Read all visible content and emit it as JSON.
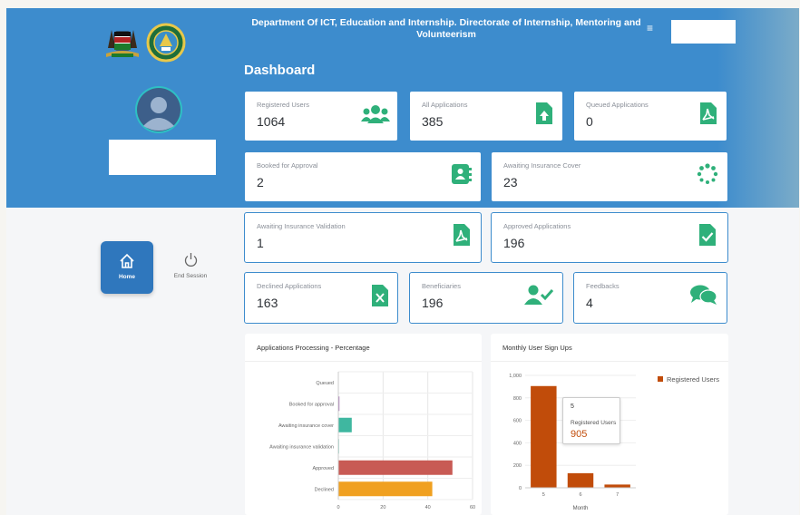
{
  "header": {
    "title": "Department Of ICT, Education and Internship. Directorate of Internship, Mentoring and Volunteerism",
    "menu_icon": "hamburger-icon"
  },
  "dashboard": {
    "title": "Dashboard"
  },
  "stats": [
    {
      "label": "Registered Users",
      "value": "1064",
      "icon": "users-icon",
      "color": "#2fb07a"
    },
    {
      "label": "All Applications",
      "value": "385",
      "icon": "file-upload-icon",
      "color": "#2fb07a"
    },
    {
      "label": "Queued Applications",
      "value": "0",
      "icon": "file-pdf-icon",
      "color": "#2fb07a"
    },
    {
      "label": "Booked for Approval",
      "value": "2",
      "icon": "address-book-icon",
      "color": "#2fb07a"
    },
    {
      "label": "Awaiting Insurance Cover",
      "value": "23",
      "icon": "spinner-icon",
      "color": "#2fb07a"
    },
    {
      "label": "Awaiting Insurance Validation",
      "value": "1",
      "icon": "file-pdf-icon",
      "color": "#2fb07a"
    },
    {
      "label": "Approved Applications",
      "value": "196",
      "icon": "file-check-icon",
      "color": "#2fb07a"
    },
    {
      "label": "Declined Applications",
      "value": "163",
      "icon": "file-excel-icon",
      "color": "#2fb07a"
    },
    {
      "label": "Beneficiaries",
      "value": "196",
      "icon": "user-check-icon",
      "color": "#2fb07a"
    },
    {
      "label": "Feedbacks",
      "value": "4",
      "icon": "comments-icon",
      "color": "#2fb07a"
    }
  ],
  "sidebar": {
    "home_label": "Home",
    "end_label": "End Session"
  },
  "chart_data": [
    {
      "type": "bar",
      "orientation": "horizontal",
      "title": "Applications Processing - Percentage",
      "categories": [
        "Queued",
        "Booked for approval",
        "Awaiting insurance cover",
        "Awaiting insurance validation",
        "Approved",
        "Declined"
      ],
      "values": [
        0,
        0.5,
        6,
        0.3,
        51,
        42
      ],
      "colors": [
        "#a56fb3",
        "#a56fb3",
        "#3fb7a0",
        "#3fb7a0",
        "#c85a54",
        "#f0a020"
      ],
      "xlim": [
        0,
        60
      ],
      "xticks": [
        "0",
        "20",
        "40",
        "60"
      ],
      "grid": true
    },
    {
      "type": "bar",
      "title": "Monthly User Sign Ups",
      "categories": [
        "5",
        "6",
        "7"
      ],
      "series": [
        {
          "name": "Registered Users",
          "values": [
            905,
            130,
            29
          ]
        }
      ],
      "xlabel": "Month",
      "ylim": [
        0,
        1000
      ],
      "yticks": [
        "0",
        "200",
        "400",
        "600",
        "800",
        "1,000"
      ],
      "color": "#c14c0a",
      "legend": "top-right",
      "tooltip": {
        "title": "5",
        "label": "Registered Users",
        "value": "905"
      }
    }
  ]
}
